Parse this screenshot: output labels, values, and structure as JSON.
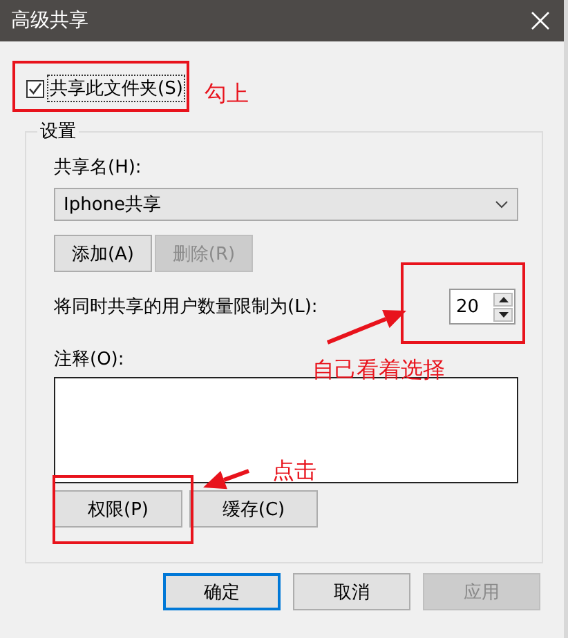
{
  "window": {
    "title": "高级共享"
  },
  "share_checkbox": {
    "label": "共享此文件夹(S)",
    "checked": true
  },
  "settings": {
    "legend": "设置",
    "share_name_label": "共享名(H):",
    "share_name": "Iphone共享",
    "name_buttons": [
      {
        "label": "添加(A)",
        "disabled": false
      },
      {
        "label": "删除(R)",
        "disabled": true
      }
    ],
    "limit_label": "将同时共享的用户数量限制为(L):",
    "limit_value": "20",
    "comment_label": "注释(O):",
    "bottom_buttons": [
      {
        "label": "权限(P)",
        "disabled": false
      },
      {
        "label": "缓存(C)",
        "disabled": false
      }
    ]
  },
  "dialog_buttons": [
    {
      "label": "确定",
      "default": true,
      "disabled": false
    },
    {
      "label": "取消",
      "default": false,
      "disabled": false
    },
    {
      "label": "应用",
      "default": false,
      "disabled": true
    }
  ],
  "annotations": [
    {
      "text": "勾上"
    },
    {
      "text": "自己看着选择"
    },
    {
      "text": "点击"
    }
  ]
}
